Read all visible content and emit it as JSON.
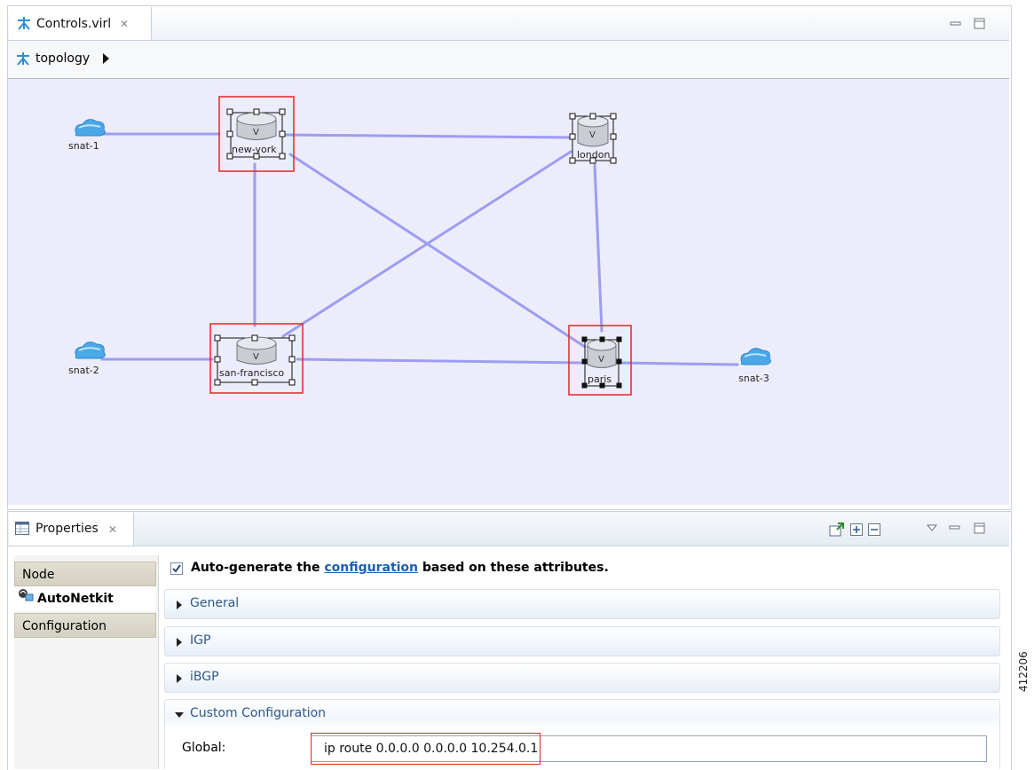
{
  "editor": {
    "tab_label": "Controls.virl",
    "tab_icon": "topology-icon",
    "breadcrumb": {
      "label": "topology",
      "icon": "topology-icon"
    }
  },
  "topology": {
    "nodes": [
      {
        "id": "snat-1",
        "label": "snat-1",
        "kind": "cloud"
      },
      {
        "id": "new-york",
        "label": "new-york",
        "kind": "router",
        "highlighted": true
      },
      {
        "id": "london",
        "label": "london",
        "kind": "router",
        "highlighted": false
      },
      {
        "id": "snat-2",
        "label": "snat-2",
        "kind": "cloud"
      },
      {
        "id": "san-francisco",
        "label": "san-francisco",
        "kind": "router",
        "highlighted": true
      },
      {
        "id": "paris",
        "label": "paris",
        "kind": "router",
        "highlighted": true
      },
      {
        "id": "snat-3",
        "label": "snat-3",
        "kind": "cloud"
      }
    ],
    "links": [
      [
        "snat-1",
        "new-york"
      ],
      [
        "new-york",
        "london"
      ],
      [
        "new-york",
        "san-francisco"
      ],
      [
        "new-york",
        "paris"
      ],
      [
        "san-francisco",
        "london"
      ],
      [
        "london",
        "paris"
      ],
      [
        "snat-2",
        "san-francisco"
      ],
      [
        "san-francisco",
        "paris"
      ],
      [
        "paris",
        "snat-3"
      ]
    ],
    "colors": {
      "canvas": "#ececfa",
      "link": "#9d9df3",
      "highlight": "#e32626"
    }
  },
  "properties": {
    "tab_label": "Properties",
    "side_nav": [
      "Node",
      "AutoNetkit",
      "Configuration"
    ],
    "active_nav": "AutoNetkit",
    "auto_generate": {
      "checked": true,
      "prefix": "Auto-generate the ",
      "link": "configuration",
      "suffix": " based on these attributes."
    },
    "sections": [
      {
        "title": "General",
        "expanded": false
      },
      {
        "title": "IGP",
        "expanded": false
      },
      {
        "title": "iBGP",
        "expanded": false
      },
      {
        "title": "Custom Configuration",
        "expanded": true
      }
    ],
    "global_label": "Global:",
    "global_value": "ip route 0.0.0.0 0.0.0.0 10.254.0.1"
  },
  "figure_id": "412206"
}
